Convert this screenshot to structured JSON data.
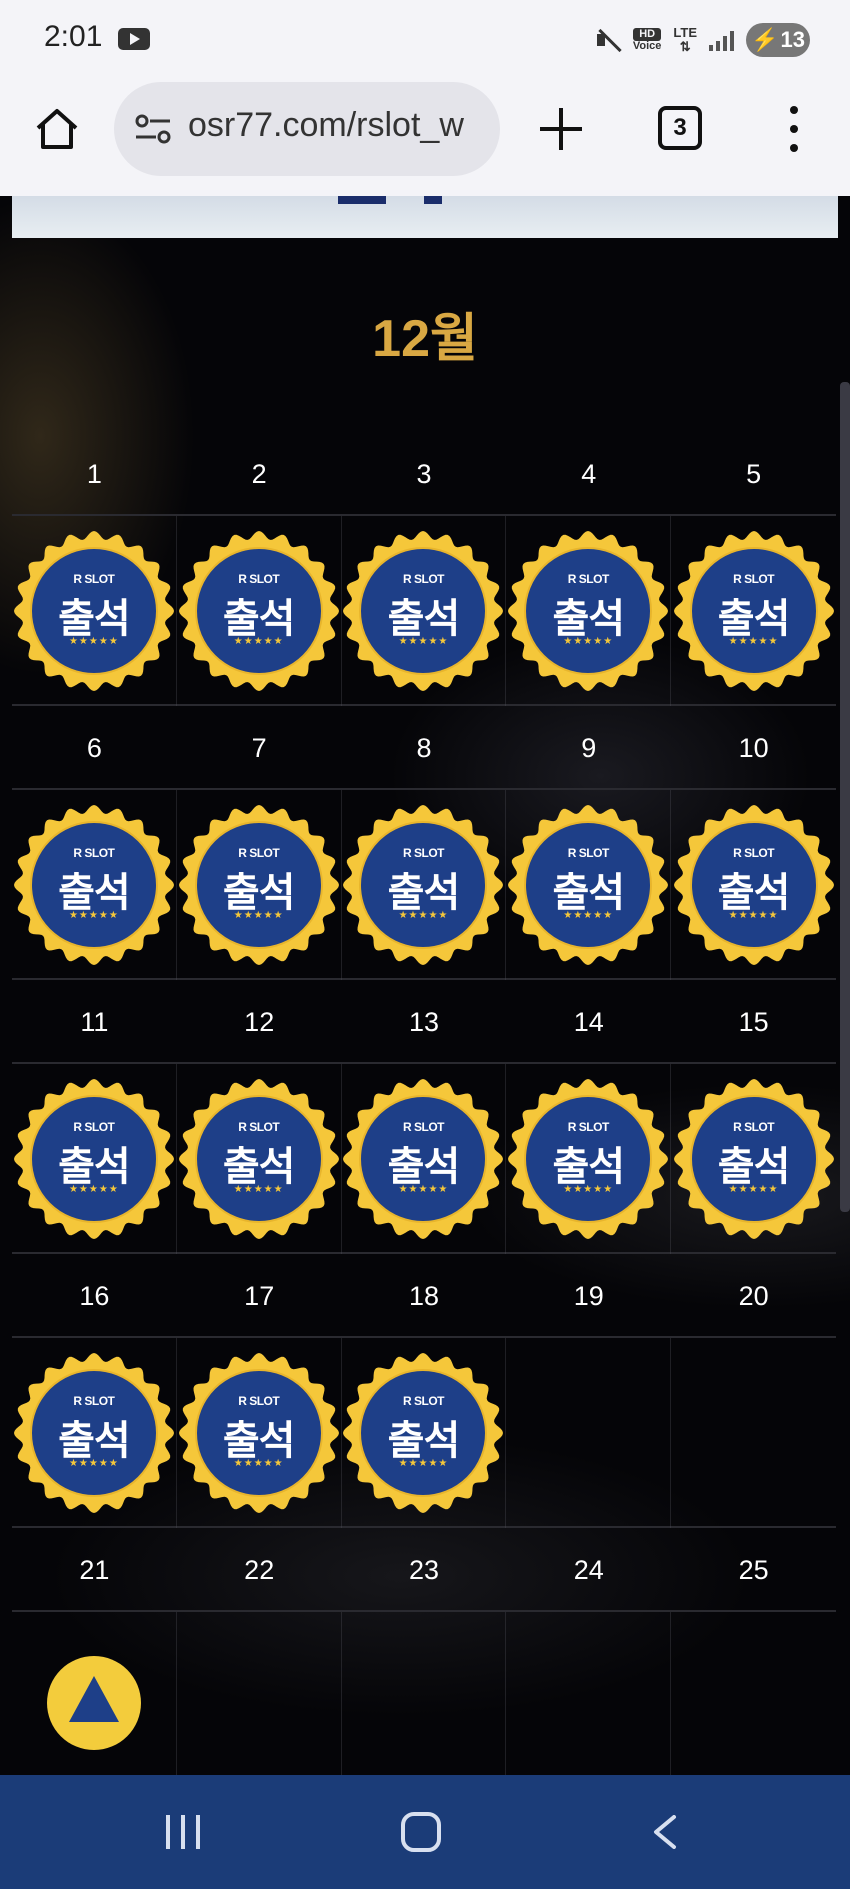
{
  "status_bar": {
    "time": "2:01",
    "network": "LTE",
    "hd_label": "HD",
    "voice_label": "Voice",
    "battery": "13"
  },
  "browser": {
    "url": "osr77.com/rslot_w",
    "tab_count": "3"
  },
  "calendar": {
    "month_title": "12월",
    "stamp": {
      "brand": "R SLOT",
      "label": "출석",
      "stars": "★★★★★"
    },
    "weeks": [
      {
        "days": [
          "1",
          "2",
          "3",
          "4",
          "5"
        ],
        "stamped": [
          true,
          true,
          true,
          true,
          true
        ]
      },
      {
        "days": [
          "6",
          "7",
          "8",
          "9",
          "10"
        ],
        "stamped": [
          true,
          true,
          true,
          true,
          true
        ]
      },
      {
        "days": [
          "11",
          "12",
          "13",
          "14",
          "15"
        ],
        "stamped": [
          true,
          true,
          true,
          true,
          true
        ]
      },
      {
        "days": [
          "16",
          "17",
          "18",
          "19",
          "20"
        ],
        "stamped": [
          true,
          true,
          true,
          false,
          false
        ]
      },
      {
        "days": [
          "21",
          "22",
          "23",
          "24",
          "25"
        ],
        "stamped": [
          false,
          false,
          false,
          false,
          false
        ]
      }
    ]
  },
  "colors": {
    "month_title": "#d9a843",
    "stamp_gold": "#f5c73a",
    "stamp_blue": "#1e3f88",
    "nav_bar": "#1b3c78"
  }
}
